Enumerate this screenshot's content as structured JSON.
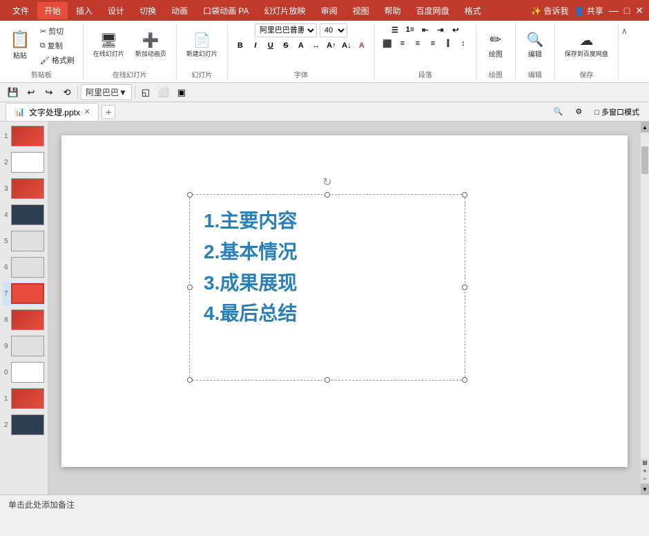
{
  "titlebar": {
    "tabs": [
      "文件",
      "开始",
      "插入",
      "设计",
      "切换",
      "动画",
      "口袋动画 PA",
      "幻灯片放映",
      "审阅",
      "视图",
      "帮助",
      "百度网盘",
      "格式"
    ],
    "active_tab": "开始",
    "right_buttons": [
      "✨ 告诉我",
      "👤 共享"
    ],
    "bg_color": "#c0392b"
  },
  "ribbon": {
    "groups": [
      {
        "name": "剪贴板",
        "buttons": [
          "粘贴",
          "剪切",
          "复制",
          "格式刷"
        ]
      },
      {
        "name": "在线幻灯片",
        "buttons": [
          "在线幻灯片",
          "新加动画页"
        ]
      },
      {
        "name": "幻灯片",
        "buttons": [
          "新建幻灯片"
        ]
      },
      {
        "name": "字体",
        "font": "阿里巴巴普惠体 B",
        "size": "40",
        "bold": "B",
        "italic": "I",
        "underline": "U",
        "strike": "S"
      },
      {
        "name": "段落",
        "buttons": [
          "列表",
          "编号",
          "缩进",
          "对齐"
        ]
      },
      {
        "name": "绘图",
        "buttons": [
          "绘图"
        ]
      },
      {
        "name": "编辑",
        "buttons": [
          "编辑"
        ]
      },
      {
        "name": "保存",
        "buttons": [
          "保存到百度网盘"
        ]
      }
    ]
  },
  "quicktoolbar": {
    "items": [
      "💾",
      "↩",
      "↪",
      "⟲",
      "阿里巴巴▼",
      "◱",
      "⬜",
      "▣"
    ]
  },
  "tabbar": {
    "doc_tab": "文字处理.pptx",
    "right_buttons": [
      "🔍",
      "⚙",
      "多窗口模式"
    ]
  },
  "slides": [
    {
      "num": "1",
      "type": "red-bg"
    },
    {
      "num": "2",
      "type": "white-bg"
    },
    {
      "num": "3",
      "type": "red-bg"
    },
    {
      "num": "4",
      "type": "dark-bg"
    },
    {
      "num": "5",
      "type": "gray-bg"
    },
    {
      "num": "6",
      "type": "gray-bg"
    },
    {
      "num": "7",
      "type": "red-current"
    },
    {
      "num": "8",
      "type": "red-bg"
    },
    {
      "num": "9",
      "type": "gray-bg"
    },
    {
      "num": "0",
      "type": "white-bg"
    },
    {
      "num": "1",
      "type": "red-bg"
    },
    {
      "num": "2",
      "type": "dark-bg"
    }
  ],
  "slide_content": {
    "text_lines": [
      "1.主要内容",
      "2.基本情况",
      "3.成果展现",
      "4.最后总结"
    ],
    "text_color": "#2980b9"
  },
  "statusbar": {
    "text": "单击此处添加备注"
  }
}
